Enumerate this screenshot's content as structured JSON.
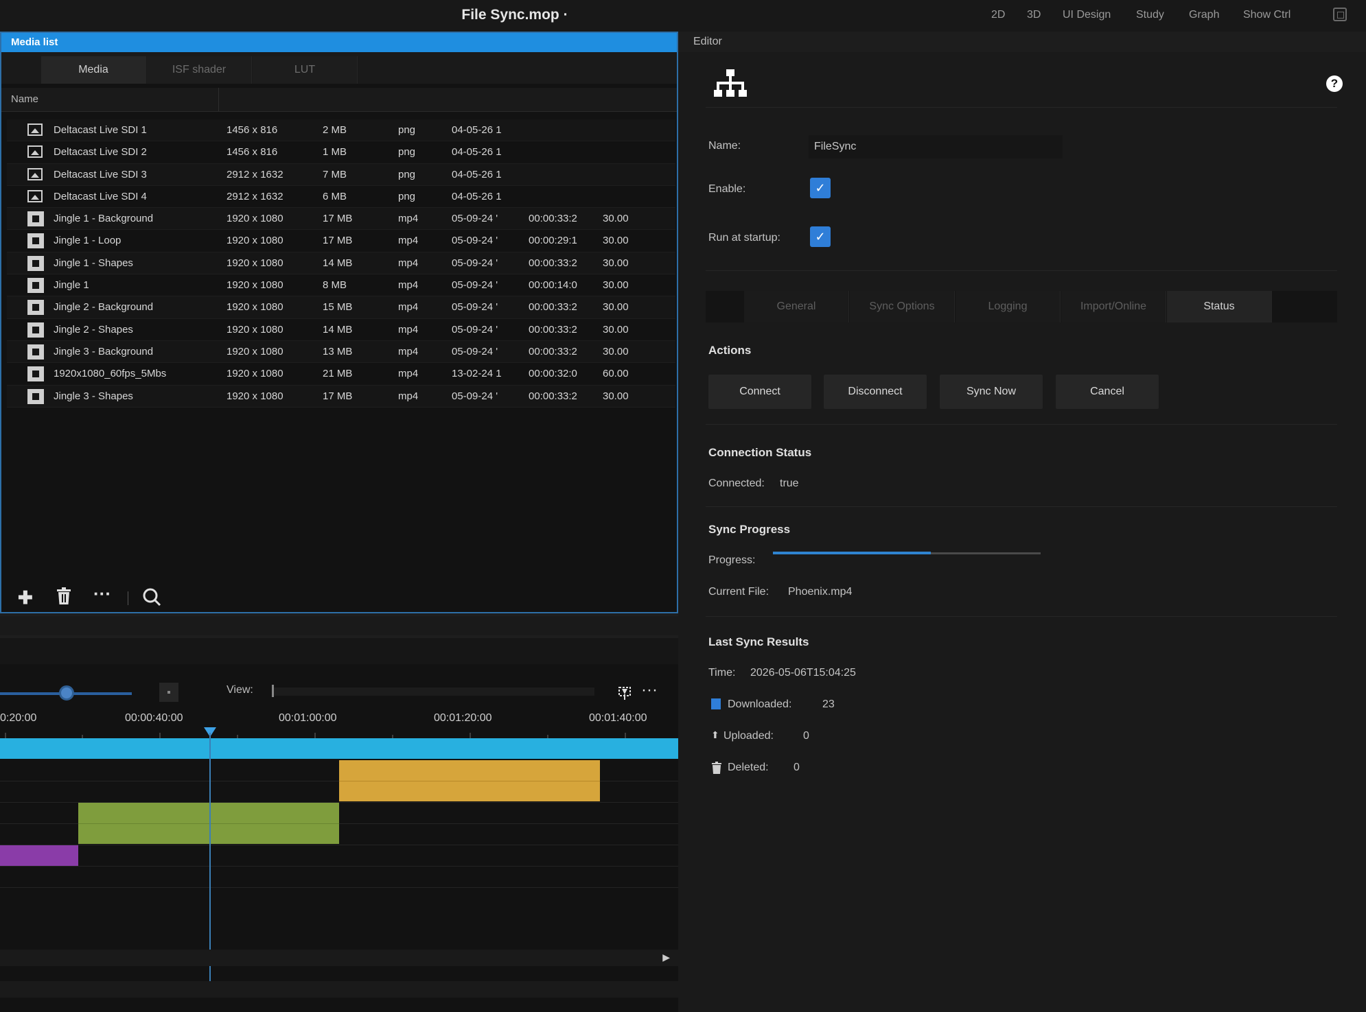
{
  "topbar": {
    "title": "File Sync.mop ·",
    "menu": [
      "2D",
      "3D",
      "UI Design",
      "Study",
      "Graph",
      "Show Ctrl"
    ]
  },
  "media_list": {
    "panel_title": "Media list",
    "tabs": [
      "Media",
      "ISF shader",
      "LUT"
    ],
    "column_name": "Name",
    "rows": [
      {
        "type": "image",
        "name": "Deltacast Live SDI 1",
        "res": "1456 x 816",
        "size": "2 MB",
        "fmt": "png",
        "date": "04-05-26 1",
        "dur": "",
        "fps": ""
      },
      {
        "type": "image",
        "name": "Deltacast Live SDI 2",
        "res": "1456 x 816",
        "size": "1 MB",
        "fmt": "png",
        "date": "04-05-26 1",
        "dur": "",
        "fps": ""
      },
      {
        "type": "image",
        "name": "Deltacast Live SDI 3",
        "res": "2912 x 1632",
        "size": "7 MB",
        "fmt": "png",
        "date": "04-05-26 1",
        "dur": "",
        "fps": ""
      },
      {
        "type": "image",
        "name": "Deltacast Live SDI 4",
        "res": "2912 x 1632",
        "size": "6 MB",
        "fmt": "png",
        "date": "04-05-26 1",
        "dur": "",
        "fps": ""
      },
      {
        "type": "video",
        "name": "Jingle 1 - Background",
        "res": "1920 x 1080",
        "size": "17 MB",
        "fmt": "mp4",
        "date": "05-09-24 '",
        "dur": "00:00:33:2",
        "fps": "30.00"
      },
      {
        "type": "video",
        "name": "Jingle 1 - Loop",
        "res": "1920 x 1080",
        "size": "17 MB",
        "fmt": "mp4",
        "date": "05-09-24 '",
        "dur": "00:00:29:1",
        "fps": "30.00"
      },
      {
        "type": "video",
        "name": "Jingle 1 - Shapes",
        "res": "1920 x 1080",
        "size": "14 MB",
        "fmt": "mp4",
        "date": "05-09-24 '",
        "dur": "00:00:33:2",
        "fps": "30.00"
      },
      {
        "type": "video",
        "name": "Jingle 1",
        "res": "1920 x 1080",
        "size": "8 MB",
        "fmt": "mp4",
        "date": "05-09-24 '",
        "dur": "00:00:14:0",
        "fps": "30.00"
      },
      {
        "type": "video",
        "name": "Jingle 2 - Background",
        "res": "1920 x 1080",
        "size": "15 MB",
        "fmt": "mp4",
        "date": "05-09-24 '",
        "dur": "00:00:33:2",
        "fps": "30.00"
      },
      {
        "type": "video",
        "name": "Jingle 2 - Shapes",
        "res": "1920 x 1080",
        "size": "14 MB",
        "fmt": "mp4",
        "date": "05-09-24 '",
        "dur": "00:00:33:2",
        "fps": "30.00"
      },
      {
        "type": "video",
        "name": "Jingle 3 - Background",
        "res": "1920 x 1080",
        "size": "13 MB",
        "fmt": "mp4",
        "date": "05-09-24 '",
        "dur": "00:00:33:2",
        "fps": "30.00"
      },
      {
        "type": "video",
        "name": "1920x1080_60fps_5Mbs",
        "res": "1920 x 1080",
        "size": "21 MB",
        "fmt": "mp4",
        "date": "13-02-24 1",
        "dur": "00:00:32:0",
        "fps": "60.00"
      },
      {
        "type": "video",
        "name": "Jingle 3 - Shapes",
        "res": "1920 x 1080",
        "size": "17 MB",
        "fmt": "mp4",
        "date": "05-09-24 '",
        "dur": "00:00:33:2",
        "fps": "30.00"
      }
    ],
    "toolbar_icons": [
      "plus-icon",
      "trash-icon",
      "more-icon",
      "search-icon"
    ]
  },
  "timeline": {
    "view_label": "View:",
    "ticks": [
      "0:20:00",
      "00:00:40:00",
      "00:01:00:00",
      "00:01:20:00",
      "00:01:40:00"
    ],
    "colors": {
      "master": "#28b0e0",
      "yellow": "#d6a53b",
      "green": "#7f9d3d",
      "purple": "#8a3ca8"
    }
  },
  "editor": {
    "header": "Editor",
    "name_label": "Name:",
    "name_value": "FileSync",
    "enable_label": "Enable:",
    "enable_checked": true,
    "startup_label": "Run at startup:",
    "startup_checked": true,
    "tabs": [
      "General",
      "Sync Options",
      "Logging",
      "Import/Online",
      "Status"
    ],
    "active_tab": "Status",
    "actions_title": "Actions",
    "actions": [
      "Connect",
      "Disconnect",
      "Sync Now",
      "Cancel"
    ],
    "connection_title": "Connection Status",
    "connected_label": "Connected:",
    "connected_value": "true",
    "progress_title": "Sync Progress",
    "progress_label": "Progress:",
    "progress_value": 0.59,
    "current_file_label": "Current File:",
    "current_file_value": "Phoenix.mp4",
    "last_title": "Last Sync Results",
    "time_label": "Time:",
    "time_value": "2026-05-06T15:04:25",
    "downloaded_label": "Downloaded:",
    "downloaded_value": "23",
    "uploaded_label": "Uploaded:",
    "uploaded_value": "0",
    "deleted_label": "Deleted:",
    "deleted_value": "0"
  }
}
